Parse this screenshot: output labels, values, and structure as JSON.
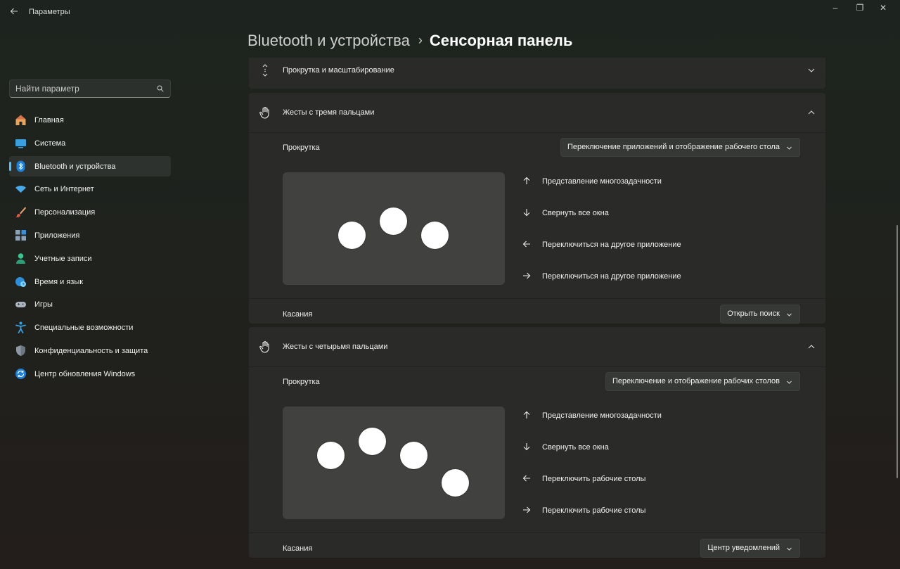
{
  "window": {
    "title": "Параметры",
    "controls": {
      "minimize": "–",
      "maximize": "❐",
      "close": "✕"
    }
  },
  "search": {
    "placeholder": "Найти параметр"
  },
  "sidebar": {
    "items": [
      {
        "label": "Главная",
        "icon": "home-icon",
        "active": false
      },
      {
        "label": "Система",
        "icon": "system-icon",
        "active": false
      },
      {
        "label": "Bluetooth и устройства",
        "icon": "bluetooth-icon",
        "active": true
      },
      {
        "label": "Сеть и Интернет",
        "icon": "wifi-icon",
        "active": false
      },
      {
        "label": "Персонализация",
        "icon": "brush-icon",
        "active": false
      },
      {
        "label": "Приложения",
        "icon": "apps-icon",
        "active": false
      },
      {
        "label": "Учетные записи",
        "icon": "person-icon",
        "active": false
      },
      {
        "label": "Время и язык",
        "icon": "globe-clock-icon",
        "active": false
      },
      {
        "label": "Игры",
        "icon": "gamepad-icon",
        "active": false
      },
      {
        "label": "Специальные возможности",
        "icon": "accessibility-icon",
        "active": false
      },
      {
        "label": "Конфиденциальность и защита",
        "icon": "shield-icon",
        "active": false
      },
      {
        "label": "Центр обновления Windows",
        "icon": "update-icon",
        "active": false
      }
    ]
  },
  "breadcrumb": {
    "parent": "Bluetooth и устройства",
    "separator": "›",
    "current": "Сенсорная панель"
  },
  "sections": {
    "scroll_zoom": {
      "label": "Прокрутка и масштабирование",
      "expanded": false
    },
    "three_finger": {
      "label": "Жесты с тремя пальцами",
      "expanded": true,
      "swipe_label": "Прокрутка",
      "swipe_value": "Переключение приложений и отображение рабочего стола",
      "actions": [
        {
          "direction": "up",
          "label": "Представление многозадачности"
        },
        {
          "direction": "down",
          "label": "Свернуть все окна"
        },
        {
          "direction": "left",
          "label": "Переключиться на другое приложение"
        },
        {
          "direction": "right",
          "label": "Переключиться на другое приложение"
        }
      ],
      "tap_label": "Касания",
      "tap_value": "Открыть поиск"
    },
    "four_finger": {
      "label": "Жесты с четырьмя пальцами",
      "expanded": true,
      "swipe_label": "Прокрутка",
      "swipe_value": "Переключение и отображение рабочих столов",
      "actions": [
        {
          "direction": "up",
          "label": "Представление многозадачности"
        },
        {
          "direction": "down",
          "label": "Свернуть все окна"
        },
        {
          "direction": "left",
          "label": "Переключить рабочие столы"
        },
        {
          "direction": "right",
          "label": "Переключить рабочие столы"
        }
      ],
      "tap_label": "Касания",
      "tap_value": "Центр уведомлений"
    }
  },
  "colors": {
    "accent": "#4cc2ff",
    "card": "#2a2b29",
    "pad": "#41423f"
  }
}
